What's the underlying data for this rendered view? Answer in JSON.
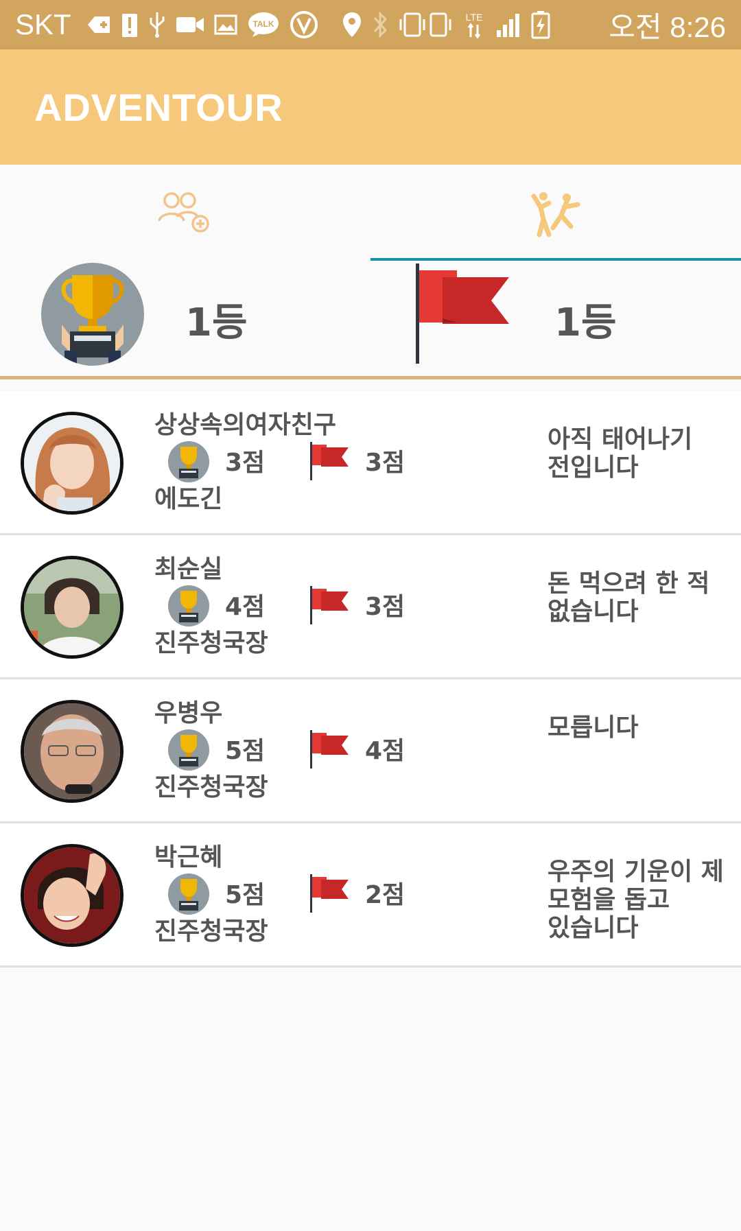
{
  "status_bar": {
    "carrier": "SKT",
    "time": "오전 8:26",
    "icons": [
      "add-icon",
      "alert-icon",
      "usb-icon",
      "video-icon",
      "image-icon",
      "talk-icon",
      "v-icon",
      "location-icon",
      "bluetooth-icon",
      "vibrate-icon",
      "lte-icon",
      "signal-icon",
      "battery-icon"
    ]
  },
  "app_bar": {
    "title": "ADVENTOUR"
  },
  "tabs": [
    {
      "icon": "friends-add-icon",
      "active": false
    },
    {
      "icon": "adventure-icon",
      "active": true
    }
  ],
  "summary": {
    "trophy_rank": "1등",
    "flag_rank": "1등"
  },
  "rows": [
    {
      "name": "상상속의여자친구",
      "trophy_score": "3점",
      "flag_score": "3점",
      "title": "에도긴",
      "message": "아직 태어나기 전입니다"
    },
    {
      "name": "최순실",
      "trophy_score": "4점",
      "flag_score": "3점",
      "title": "진주청국장",
      "message": "돈 먹으려 한 적 없습니다"
    },
    {
      "name": "우병우",
      "trophy_score": "5점",
      "flag_score": "4점",
      "title": "진주청국장",
      "message": "모릅니다"
    },
    {
      "name": "박근혜",
      "trophy_score": "5점",
      "flag_score": "2점",
      "title": "진주청국장",
      "message": "우주의 기운이 제 모험을 돕고 있습니다"
    }
  ],
  "colors": {
    "status_bar": "#d2a55f",
    "app_bar": "#f6c87c",
    "tab_indicator": "#1b8fb0",
    "flag_red": "#d32f2f",
    "trophy_gold": "#f2b705",
    "trophy_circle": "#8f9aa1"
  }
}
